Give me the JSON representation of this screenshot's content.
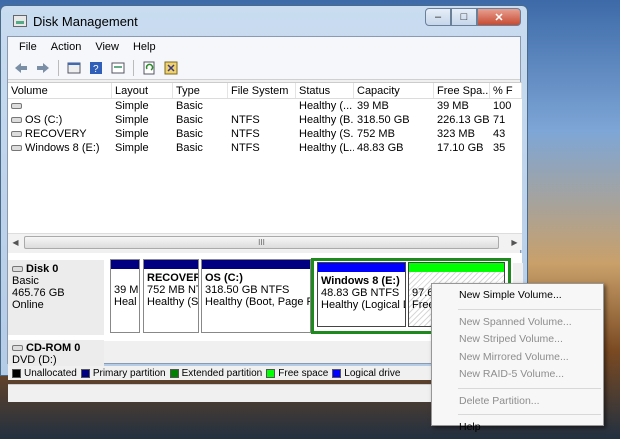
{
  "window": {
    "title": "Disk Management"
  },
  "menu": [
    "File",
    "Action",
    "View",
    "Help"
  ],
  "columns": [
    "Volume",
    "Layout",
    "Type",
    "File System",
    "Status",
    "Capacity",
    "Free Spa...",
    "% F"
  ],
  "volumes": [
    {
      "volume": "",
      "layout": "Simple",
      "type": "Basic",
      "fs": "",
      "status": "Healthy (...",
      "capacity": "39 MB",
      "free": "39 MB",
      "pct": "100"
    },
    {
      "volume": "OS (C:)",
      "layout": "Simple",
      "type": "Basic",
      "fs": "NTFS",
      "status": "Healthy (B...",
      "capacity": "318.50 GB",
      "free": "226.13 GB",
      "pct": "71"
    },
    {
      "volume": "RECOVERY",
      "layout": "Simple",
      "type": "Basic",
      "fs": "NTFS",
      "status": "Healthy (S...",
      "capacity": "752 MB",
      "free": "323 MB",
      "pct": "43"
    },
    {
      "volume": "Windows 8 (E:)",
      "layout": "Simple",
      "type": "Basic",
      "fs": "NTFS",
      "status": "Healthy (L...",
      "capacity": "48.83 GB",
      "free": "17.10 GB",
      "pct": "35"
    }
  ],
  "scroll": {
    "thumb": "III"
  },
  "disk0": {
    "name": "Disk 0",
    "type": "Basic",
    "size": "465.76 GB",
    "state": "Online"
  },
  "partitions": [
    {
      "name": "",
      "size": "39 M",
      "status": "Heal",
      "color": "#000080"
    },
    {
      "name": "RECOVERY",
      "size": "752 MB NT",
      "status": "Healthy (S",
      "color": "#000080"
    },
    {
      "name": "OS (C:)",
      "size": "318.50 GB NTFS",
      "status": "Healthy (Boot, Page File",
      "color": "#000080"
    },
    {
      "name": "Windows 8 (E:)",
      "size": "48.83 GB NTFS",
      "status": "Healthy (Logical D",
      "color": "#0000ff"
    },
    {
      "name": "",
      "size": "97.66 GB",
      "status": "Free space",
      "color": "#00ff00"
    }
  ],
  "cdrom": {
    "name": "CD-ROM 0",
    "drive": "DVD (D:)"
  },
  "legend": [
    {
      "label": "Unallocated",
      "color": "#000000"
    },
    {
      "label": "Primary partition",
      "color": "#000080"
    },
    {
      "label": "Extended partition",
      "color": "#008000"
    },
    {
      "label": "Free space",
      "color": "#00ff00"
    },
    {
      "label": "Logical drive",
      "color": "#0000ff"
    }
  ],
  "context_menu": [
    {
      "label": "New Simple Volume...",
      "enabled": true
    },
    {
      "label": "New Spanned Volume...",
      "enabled": false
    },
    {
      "label": "New Striped Volume...",
      "enabled": false
    },
    {
      "label": "New Mirrored Volume...",
      "enabled": false
    },
    {
      "label": "New RAID-5 Volume...",
      "enabled": false
    },
    {
      "label": "Delete Partition...",
      "enabled": false
    },
    {
      "label": "Help",
      "enabled": true
    }
  ]
}
